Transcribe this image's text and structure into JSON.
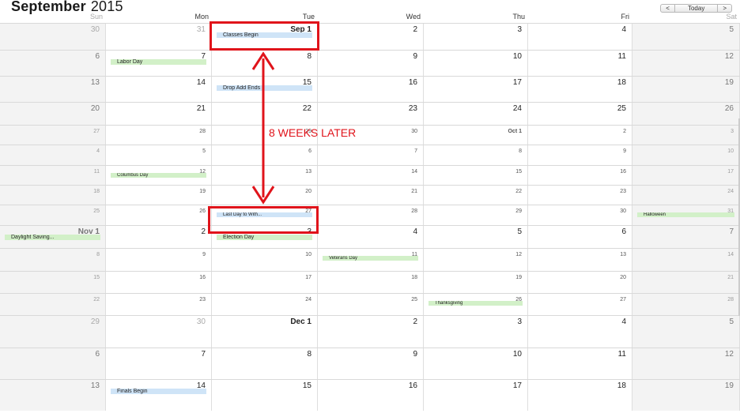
{
  "header": {
    "month": "September",
    "year": "2015"
  },
  "nav": {
    "prev": "<",
    "today": "Today",
    "next": ">"
  },
  "weekdays": [
    "Sun",
    "Mon",
    "Tue",
    "Wed",
    "Thu",
    "Fri",
    "Sat"
  ],
  "annotation": {
    "text": "8 WEEKS LATER"
  },
  "weeks": [
    {
      "days": [
        "30",
        "31",
        "Sep 1",
        "2",
        "3",
        "4",
        "5"
      ]
    },
    {
      "days": [
        "6",
        "7",
        "8",
        "9",
        "10",
        "11",
        "12"
      ]
    },
    {
      "days": [
        "13",
        "14",
        "15",
        "16",
        "17",
        "18",
        "19"
      ]
    },
    {
      "days": [
        "20",
        "21",
        "22",
        "23",
        "24",
        "25",
        "26"
      ]
    },
    {
      "days": [
        "27",
        "28",
        "29",
        "30",
        "Oct 1",
        "2",
        "3"
      ]
    },
    {
      "days": [
        "4",
        "5",
        "6",
        "7",
        "8",
        "9",
        "10"
      ]
    },
    {
      "days": [
        "11",
        "12",
        "13",
        "14",
        "15",
        "16",
        "17"
      ]
    },
    {
      "days": [
        "18",
        "19",
        "20",
        "21",
        "22",
        "23",
        "24"
      ]
    },
    {
      "days": [
        "25",
        "26",
        "27",
        "28",
        "29",
        "30",
        "31"
      ]
    },
    {
      "days": [
        "Nov 1",
        "2",
        "3",
        "4",
        "5",
        "6",
        "7"
      ]
    },
    {
      "days": [
        "8",
        "9",
        "10",
        "11",
        "12",
        "13",
        "14"
      ]
    },
    {
      "days": [
        "15",
        "16",
        "17",
        "18",
        "19",
        "20",
        "21"
      ]
    },
    {
      "days": [
        "22",
        "23",
        "24",
        "25",
        "26",
        "27",
        "28"
      ]
    },
    {
      "days": [
        "29",
        "30",
        "Dec 1",
        "2",
        "3",
        "4",
        "5"
      ]
    },
    {
      "days": [
        "6",
        "7",
        "8",
        "9",
        "10",
        "11",
        "12"
      ]
    },
    {
      "days": [
        "13",
        "14",
        "15",
        "16",
        "17",
        "18",
        "19"
      ]
    }
  ],
  "events": [
    {
      "week": 0,
      "day": 2,
      "label": "Classes Begin",
      "color": "blue"
    },
    {
      "week": 1,
      "day": 1,
      "label": "Labor Day",
      "color": "green"
    },
    {
      "week": 2,
      "day": 2,
      "label": "Drop Add Ends",
      "color": "blue"
    },
    {
      "week": 6,
      "day": 1,
      "label": "Columbus Day",
      "color": "green"
    },
    {
      "week": 8,
      "day": 2,
      "label": "Last Day to With...",
      "color": "blue"
    },
    {
      "week": 8,
      "day": 6,
      "label": "Halloween",
      "color": "green"
    },
    {
      "week": 9,
      "day": 0,
      "label": "Daylight Saving...",
      "color": "green"
    },
    {
      "week": 9,
      "day": 2,
      "label": "Election Day",
      "color": "green"
    },
    {
      "week": 10,
      "day": 3,
      "label": "Veterans Day",
      "color": "green"
    },
    {
      "week": 12,
      "day": 4,
      "label": "Thanksgiving",
      "color": "green"
    },
    {
      "week": 15,
      "day": 1,
      "label": "Finals Begin",
      "color": "blue"
    }
  ],
  "colors": {
    "highlight": "#e0141b",
    "event_blue": "#cfe4f7",
    "event_green": "#d2f0c8"
  }
}
